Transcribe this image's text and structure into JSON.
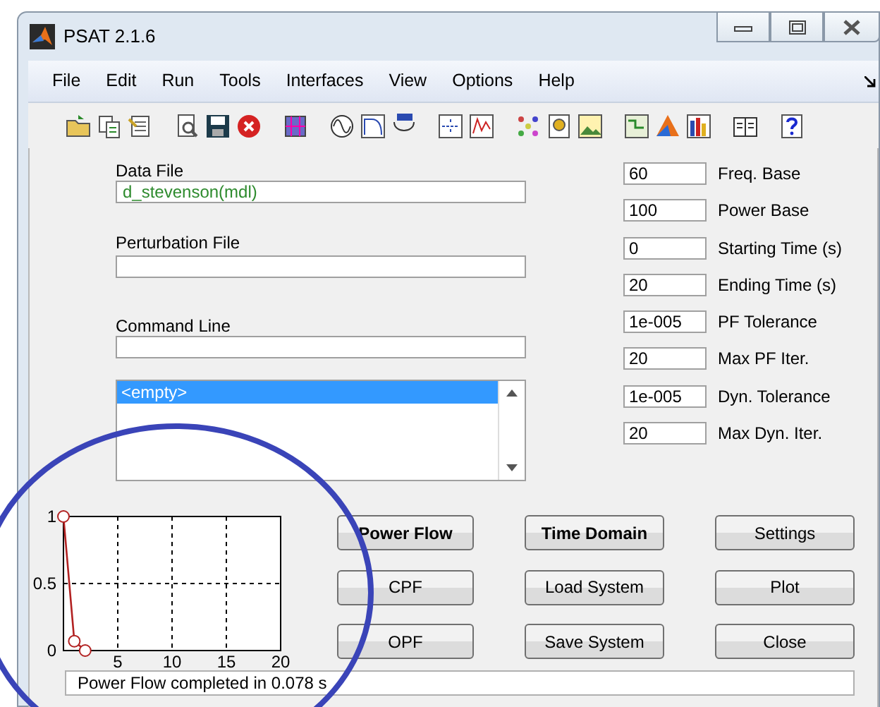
{
  "window": {
    "title": "PSAT 2.1.6"
  },
  "menu": [
    "File",
    "Edit",
    "Run",
    "Tools",
    "Interfaces",
    "View",
    "Options",
    "Help"
  ],
  "data_file": {
    "label": "Data File",
    "value": "d_stevenson(mdl)"
  },
  "perturbation_file": {
    "label": "Perturbation File"
  },
  "command_line": {
    "label": "Command Line"
  },
  "listbox": {
    "items": [
      {
        "text": "<empty>",
        "selected": true
      }
    ]
  },
  "settings": [
    {
      "value": "60",
      "label": "Freq. Base"
    },
    {
      "value": "100",
      "label": "Power Base"
    },
    {
      "value": "0",
      "label": "Starting Time (s)"
    },
    {
      "value": "20",
      "label": "Ending Time (s)"
    },
    {
      "value": "1e-005",
      "label": "PF Tolerance"
    },
    {
      "value": "20",
      "label": "Max PF Iter."
    },
    {
      "value": "1e-005",
      "label": "Dyn. Tolerance"
    },
    {
      "value": "20",
      "label": "Max Dyn. Iter."
    }
  ],
  "chart_data": {
    "type": "line",
    "x": [
      0,
      1,
      2
    ],
    "series": [
      {
        "color": "#b22222",
        "marker": "o",
        "values": [
          1,
          0.07,
          0
        ]
      }
    ],
    "grid": true,
    "xlim": [
      0,
      20
    ],
    "ylim": [
      0,
      1
    ],
    "xticks": [
      5,
      10,
      15,
      20
    ],
    "yticks": [
      0,
      0.5,
      1
    ]
  },
  "buttons": [
    {
      "label": "Power Flow",
      "bold": true
    },
    {
      "label": "Time Domain",
      "bold": true
    },
    {
      "label": "Settings",
      "bold": false
    },
    {
      "label": "CPF",
      "bold": false
    },
    {
      "label": "Load System",
      "bold": false
    },
    {
      "label": "Plot",
      "bold": false
    },
    {
      "label": "OPF",
      "bold": false
    },
    {
      "label": "Save System",
      "bold": false
    },
    {
      "label": "Close",
      "bold": false
    }
  ],
  "status_bar": "Power Flow completed in 0.078 s"
}
